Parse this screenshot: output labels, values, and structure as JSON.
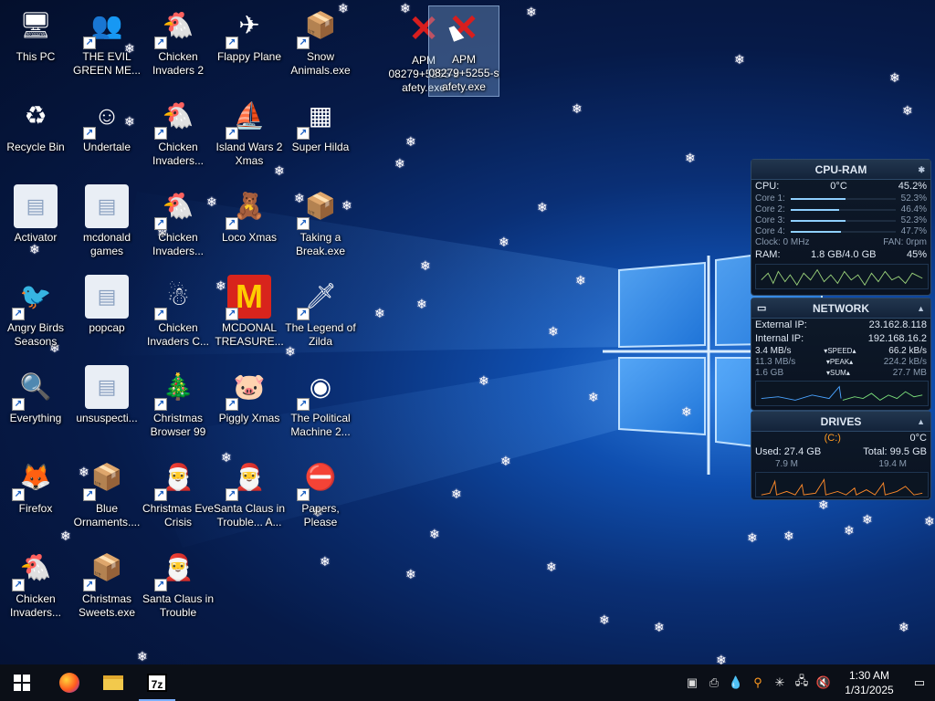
{
  "desktop": {
    "icons": [
      {
        "label": "This PC",
        "icon": "computer-icon",
        "glyph": "🖥"
      },
      {
        "label": "THE EVIL GREEN ME...",
        "icon": "msn-people-icon",
        "glyph": "👥"
      },
      {
        "label": "Chicken Invaders 2",
        "icon": "chicken-invaders-icon",
        "glyph": "🐔"
      },
      {
        "label": "Flappy Plane",
        "icon": "flappy-plane-icon",
        "glyph": "✈"
      },
      {
        "label": "Snow Animals.exe",
        "icon": "exe-package-icon",
        "glyph": "📦"
      },
      {
        "label": "Recycle Bin",
        "icon": "recycle-bin-icon",
        "glyph": "♻"
      },
      {
        "label": "Undertale",
        "icon": "undertale-icon",
        "glyph": "☺"
      },
      {
        "label": "Chicken Invaders...",
        "icon": "chicken-invaders-icon",
        "glyph": "🐔"
      },
      {
        "label": "Island Wars 2 Xmas",
        "icon": "island-wars-icon",
        "glyph": "⛵"
      },
      {
        "label": "Super Hilda",
        "icon": "super-hilda-icon",
        "glyph": "▦"
      },
      {
        "label": "Activator",
        "icon": "folder-icon",
        "glyph": "▤"
      },
      {
        "label": "mcdonald games",
        "icon": "folder-icon",
        "glyph": "▤"
      },
      {
        "label": "Chicken Invaders...",
        "icon": "chicken-invaders-icon",
        "glyph": "🐔"
      },
      {
        "label": "Loco Xmas",
        "icon": "teddy-bear-icon",
        "glyph": "🧸"
      },
      {
        "label": "Taking a Break.exe",
        "icon": "exe-package-icon",
        "glyph": "📦"
      },
      {
        "label": "Angry Birds Seasons",
        "icon": "angry-birds-icon",
        "glyph": "🐦"
      },
      {
        "label": "popcap",
        "icon": "folder-icon",
        "glyph": "▤"
      },
      {
        "label": "Chicken Invaders C...",
        "icon": "chicken-invaders-icon",
        "glyph": "☃"
      },
      {
        "label": "MCDONAL TREASURE...",
        "icon": "mcdonalds-icon",
        "glyph": "M"
      },
      {
        "label": "The Legend of Zilda",
        "icon": "legend-zilda-icon",
        "glyph": "🗡"
      },
      {
        "label": "Everything",
        "icon": "everything-search-icon",
        "glyph": "🔍"
      },
      {
        "label": "unsuspecti...",
        "icon": "folder-icon",
        "glyph": "▤"
      },
      {
        "label": "Christmas Browser 99",
        "icon": "christmas-tree-icon",
        "glyph": "🎄"
      },
      {
        "label": "Piggly Xmas",
        "icon": "pig-icon",
        "glyph": "🐷"
      },
      {
        "label": "The Political Machine 2...",
        "icon": "political-machine-icon",
        "glyph": "◉"
      },
      {
        "label": "Firefox",
        "icon": "firefox-icon",
        "glyph": "🦊"
      },
      {
        "label": "Blue Ornaments....",
        "icon": "exe-package-icon",
        "glyph": "📦"
      },
      {
        "label": "Christmas Eve Crisis",
        "icon": "santa-icon",
        "glyph": "🎅"
      },
      {
        "label": "Santa Claus in Trouble... A...",
        "icon": "santa-icon",
        "glyph": "🎅"
      },
      {
        "label": "Papers, Please",
        "icon": "papers-please-icon",
        "glyph": "⛔"
      },
      {
        "label": "Chicken Invaders...",
        "icon": "chicken-invaders-icon",
        "glyph": "🐔"
      },
      {
        "label": "Christmas Sweets.exe",
        "icon": "exe-package-icon",
        "glyph": "📦"
      },
      {
        "label": "Santa Claus in Trouble",
        "icon": "santa-icon",
        "glyph": "🎅"
      }
    ],
    "apm_icons": [
      {
        "label": "APM 08279+5255-safety.exe",
        "line1": "APM",
        "line2": "08279+5255-s",
        "line3": "afety.exe"
      },
      {
        "label": "APM 08279+5255-safety.exe",
        "line1": "APM",
        "line2": "08279+5255-s",
        "line3": "afety.exe"
      }
    ]
  },
  "cpu_gadget": {
    "title": "CPU-RAM",
    "cpu_label": "CPU:",
    "cpu_temp": "0°C",
    "cpu_total": "45.2%",
    "cores": [
      {
        "label": "Core 1:",
        "value": "52.3%",
        "level": 0.52
      },
      {
        "label": "Core 2:",
        "value": "46.4%",
        "level": 0.46
      },
      {
        "label": "Core 3:",
        "value": "52.3%",
        "level": 0.52
      },
      {
        "label": "Core 4:",
        "value": "47.7%",
        "level": 0.48
      }
    ],
    "clock": "Clock: 0 MHz",
    "fan": "FAN: 0rpm",
    "ram_label": "RAM:",
    "ram_used": "1.8 GB/4.0 GB",
    "ram_percent": "45%"
  },
  "network_gadget": {
    "title": "NETWORK",
    "external_ip_label": "External IP:",
    "external_ip": "23.162.8.118",
    "internal_ip_label": "Internal IP:",
    "internal_ip": "192.168.16.2",
    "speed_down": "3.4 MB/s",
    "speed_label": "SPEED",
    "speed_up": "66.2 kB/s",
    "peak_down": "11.3 MB/s",
    "peak_label": "PEAK",
    "peak_up": "224.2 kB/s",
    "sum_down": "1.6 GB",
    "sum_label": "SUM",
    "sum_up": "27.7 MB"
  },
  "drives_gadget": {
    "title": "DRIVES",
    "drive": "(C:)",
    "temp": "0°C",
    "used": "Used: 27.4 GB",
    "total": "Total: 99.5 GB",
    "read": "7.9 M",
    "write": "19.4 M"
  },
  "taskbar": {
    "clock_time": "1:30 AM",
    "clock_date": "1/31/2025",
    "apps": [
      {
        "name": "start-button"
      },
      {
        "name": "taskbar-firefox"
      },
      {
        "name": "taskbar-file-explorer"
      },
      {
        "name": "taskbar-7zip",
        "label": "7z"
      }
    ]
  },
  "colors": {
    "accent": "#7cb0ff",
    "gadget_border": "#2c4868",
    "drive_orange": "#ff9a20"
  }
}
